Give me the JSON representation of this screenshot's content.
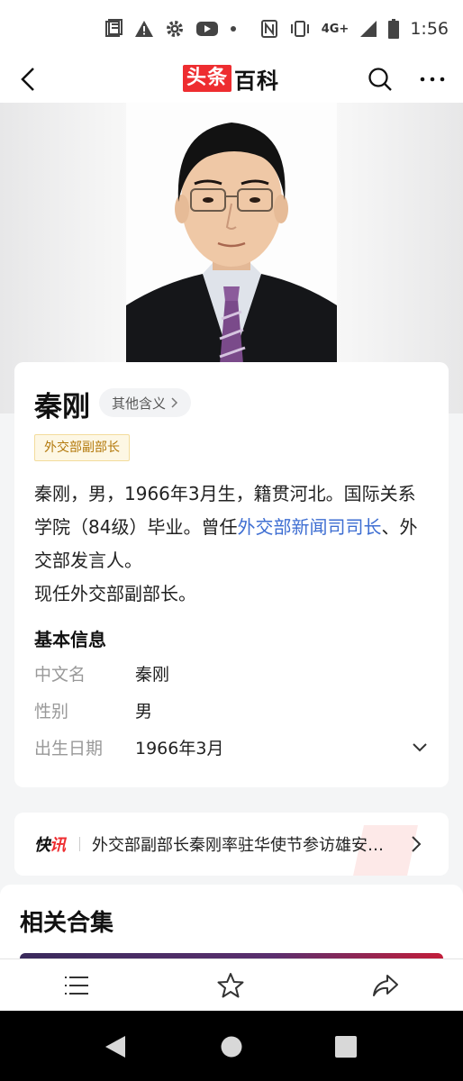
{
  "status_bar": {
    "network": "4G+",
    "time": "1:56"
  },
  "nav": {
    "brand_red": "头条",
    "brand_black": "百科"
  },
  "entry": {
    "title": "秦刚",
    "other_meanings_label": "其他含义",
    "tag": "外交部副部长",
    "summary_part1": "秦刚，男，1966年3月生，籍贯河北。国际关系学院（84级）毕业。曾任",
    "summary_link": "外交部新闻司司长",
    "summary_part2": "、外交部发言人。",
    "summary_line2": "现任外交部副部长。"
  },
  "basic_info": {
    "section_title": "基本信息",
    "rows": [
      {
        "label": "中文名",
        "value": "秦刚"
      },
      {
        "label": "性别",
        "value": "男"
      },
      {
        "label": "出生日期",
        "value": "1966年3月"
      }
    ]
  },
  "news": {
    "logo_main": "快",
    "logo_accent": "讯",
    "headline": "外交部副部长秦刚率驻华使节参访雄安新区"
  },
  "related": {
    "title": "相关合集"
  },
  "colors": {
    "brand_red": "#ee2d30",
    "link_blue": "#3e6ed2",
    "tag_text": "#b3790c",
    "tag_bg": "#fdf7e4"
  }
}
